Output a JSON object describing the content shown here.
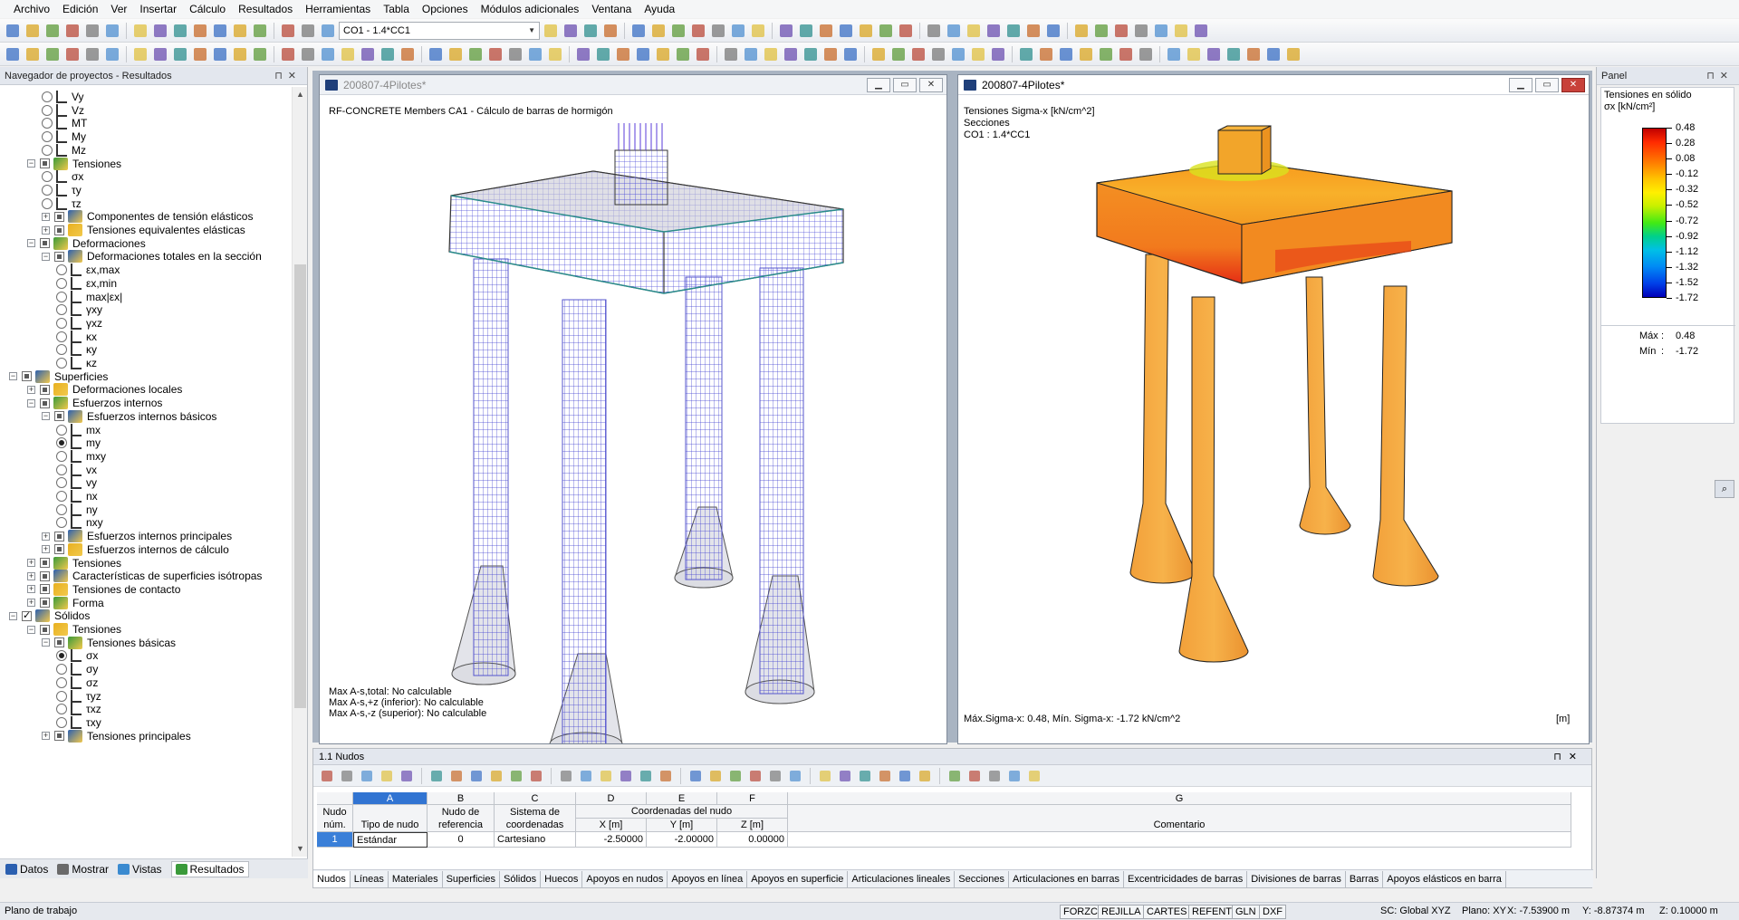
{
  "menu": [
    "Archivo",
    "Edición",
    "Ver",
    "Insertar",
    "Cálculo",
    "Resultados",
    "Herramientas",
    "Tabla",
    "Opciones",
    "Módulos adicionales",
    "Ventana",
    "Ayuda"
  ],
  "toolbar": {
    "loadcase": "CO1 - 1.4*CC1"
  },
  "navigator": {
    "title": "Navegador de proyectos - Resultados",
    "items": [
      {
        "label": "Vy",
        "level": 3,
        "kind": "radio"
      },
      {
        "label": "Vz",
        "level": 3,
        "kind": "radio"
      },
      {
        "label": "MT",
        "level": 3,
        "kind": "radio"
      },
      {
        "label": "My",
        "level": 3,
        "kind": "radio"
      },
      {
        "label": "Mz",
        "level": 3,
        "kind": "radio"
      },
      {
        "label": "Tensiones",
        "level": 2,
        "kind": "group"
      },
      {
        "label": "σx",
        "level": 3,
        "kind": "radio"
      },
      {
        "label": "τy",
        "level": 3,
        "kind": "radio"
      },
      {
        "label": "τz",
        "level": 3,
        "kind": "radio"
      },
      {
        "label": "Componentes de tensión elásticos",
        "level": 3,
        "kind": "group-c"
      },
      {
        "label": "Tensiones equivalentes elásticas",
        "level": 3,
        "kind": "group-c"
      },
      {
        "label": "Deformaciones",
        "level": 2,
        "kind": "group"
      },
      {
        "label": "Deformaciones totales en la sección",
        "level": 3,
        "kind": "group"
      },
      {
        "label": "εx,max",
        "level": 4,
        "kind": "radio"
      },
      {
        "label": "εx,min",
        "level": 4,
        "kind": "radio"
      },
      {
        "label": "max|εx|",
        "level": 4,
        "kind": "radio"
      },
      {
        "label": "γxy",
        "level": 4,
        "kind": "radio"
      },
      {
        "label": "γxz",
        "level": 4,
        "kind": "radio"
      },
      {
        "label": "κx",
        "level": 4,
        "kind": "radio"
      },
      {
        "label": "κy",
        "level": 4,
        "kind": "radio"
      },
      {
        "label": "κz",
        "level": 4,
        "kind": "radio"
      },
      {
        "label": "Superficies",
        "level": 1,
        "kind": "group"
      },
      {
        "label": "Deformaciones locales",
        "level": 2,
        "kind": "group-c"
      },
      {
        "label": "Esfuerzos internos",
        "level": 2,
        "kind": "group"
      },
      {
        "label": "Esfuerzos internos básicos",
        "level": 3,
        "kind": "group"
      },
      {
        "label": "mx",
        "level": 4,
        "kind": "radio"
      },
      {
        "label": "my",
        "level": 4,
        "kind": "radio-on"
      },
      {
        "label": "mxy",
        "level": 4,
        "kind": "radio"
      },
      {
        "label": "vx",
        "level": 4,
        "kind": "radio"
      },
      {
        "label": "vy",
        "level": 4,
        "kind": "radio"
      },
      {
        "label": "nx",
        "level": 4,
        "kind": "radio"
      },
      {
        "label": "ny",
        "level": 4,
        "kind": "radio"
      },
      {
        "label": "nxy",
        "level": 4,
        "kind": "radio"
      },
      {
        "label": "Esfuerzos internos principales",
        "level": 3,
        "kind": "group-c"
      },
      {
        "label": "Esfuerzos internos de cálculo",
        "level": 3,
        "kind": "group-c"
      },
      {
        "label": "Tensiones",
        "level": 2,
        "kind": "group-c"
      },
      {
        "label": "Características de superficies isótropas",
        "level": 2,
        "kind": "group-c"
      },
      {
        "label": "Tensiones de contacto",
        "level": 2,
        "kind": "group-c"
      },
      {
        "label": "Forma",
        "level": 2,
        "kind": "group-c"
      },
      {
        "label": "Sólidos",
        "level": 1,
        "kind": "group-on"
      },
      {
        "label": "Tensiones",
        "level": 2,
        "kind": "group"
      },
      {
        "label": "Tensiones básicas",
        "level": 3,
        "kind": "group"
      },
      {
        "label": "σx",
        "level": 4,
        "kind": "radio-on"
      },
      {
        "label": "σy",
        "level": 4,
        "kind": "radio"
      },
      {
        "label": "σz",
        "level": 4,
        "kind": "radio"
      },
      {
        "label": "τyz",
        "level": 4,
        "kind": "radio"
      },
      {
        "label": "τxz",
        "level": 4,
        "kind": "radio"
      },
      {
        "label": "τxy",
        "level": 4,
        "kind": "radio"
      },
      {
        "label": "Tensiones principales",
        "level": 3,
        "kind": "group-c"
      }
    ],
    "tabs": [
      "Datos",
      "Mostrar",
      "Vistas",
      "Resultados"
    ]
  },
  "window1": {
    "title": "200807-4Pilotes*",
    "header": "RF-CONCRETE Members CA1 - Cálculo de barras de hormigón",
    "footer": [
      "Max A-s,total: No calculable",
      "Max A-s,+z (inferior): No calculable",
      "Max A-s,-z (superior): No calculable"
    ]
  },
  "window2": {
    "title": "200807-4Pilotes*",
    "header": [
      "Tensiones Sigma-x [kN/cm^2]",
      "Secciones",
      "CO1 : 1.4*CC1"
    ],
    "footer": "Máx.Sigma-x: 0.48, Mín. Sigma-x: -1.72 kN/cm^2",
    "unit": "[m]"
  },
  "panel": {
    "title": "Panel",
    "subtitle": "Tensiones en sólido",
    "unit": "σx [kN/cm²]",
    "legend": [
      "0.48",
      "0.28",
      "0.08",
      "-0.12",
      "-0.32",
      "-0.52",
      "-0.72",
      "-0.92",
      "-1.12",
      "-1.32",
      "-1.52",
      "-1.72"
    ],
    "max_label": "Máx",
    "max_value": "0.48",
    "min_label": "Mín",
    "min_value": "-1.72"
  },
  "table": {
    "title": "1.1 Nudos",
    "letters": [
      "A",
      "B",
      "C",
      "D",
      "E",
      "F",
      "G"
    ],
    "headers": {
      "node": "Nudo núm.",
      "type": "Tipo de nudo",
      "ref": "Nudo de referencia",
      "sys": "Sistema de coordenadas",
      "coords": "Coordenadas del nudo",
      "x": "X [m]",
      "y": "Y [m]",
      "z": "Z [m]",
      "comment": "Comentario"
    },
    "row": {
      "num": "1",
      "type": "Estándar",
      "ref": "0",
      "sys": "Cartesiano",
      "x": "-2.50000",
      "y": "-2.00000",
      "z": "0.00000"
    },
    "tabs": [
      "Nudos",
      "Líneas",
      "Materiales",
      "Superficies",
      "Sólidos",
      "Huecos",
      "Apoyos en nudos",
      "Apoyos en línea",
      "Apoyos en superficie",
      "Articulaciones lineales",
      "Secciones",
      "Articulaciones en barras",
      "Excentricidades de barras",
      "Divisiones de barras",
      "Barras",
      "Apoyos elásticos en barra"
    ]
  },
  "status": {
    "left": "Plano de trabajo",
    "buttons": [
      "FORZC",
      "REJILLA",
      "CARTES",
      "REFENT",
      "GLN",
      "DXF"
    ],
    "sc": "SC: Global XYZ",
    "plane": "Plano: XY",
    "x": "X: -7.53900 m",
    "y": "Y: -8.87374 m",
    "z": "Z: 0.10000 m"
  }
}
